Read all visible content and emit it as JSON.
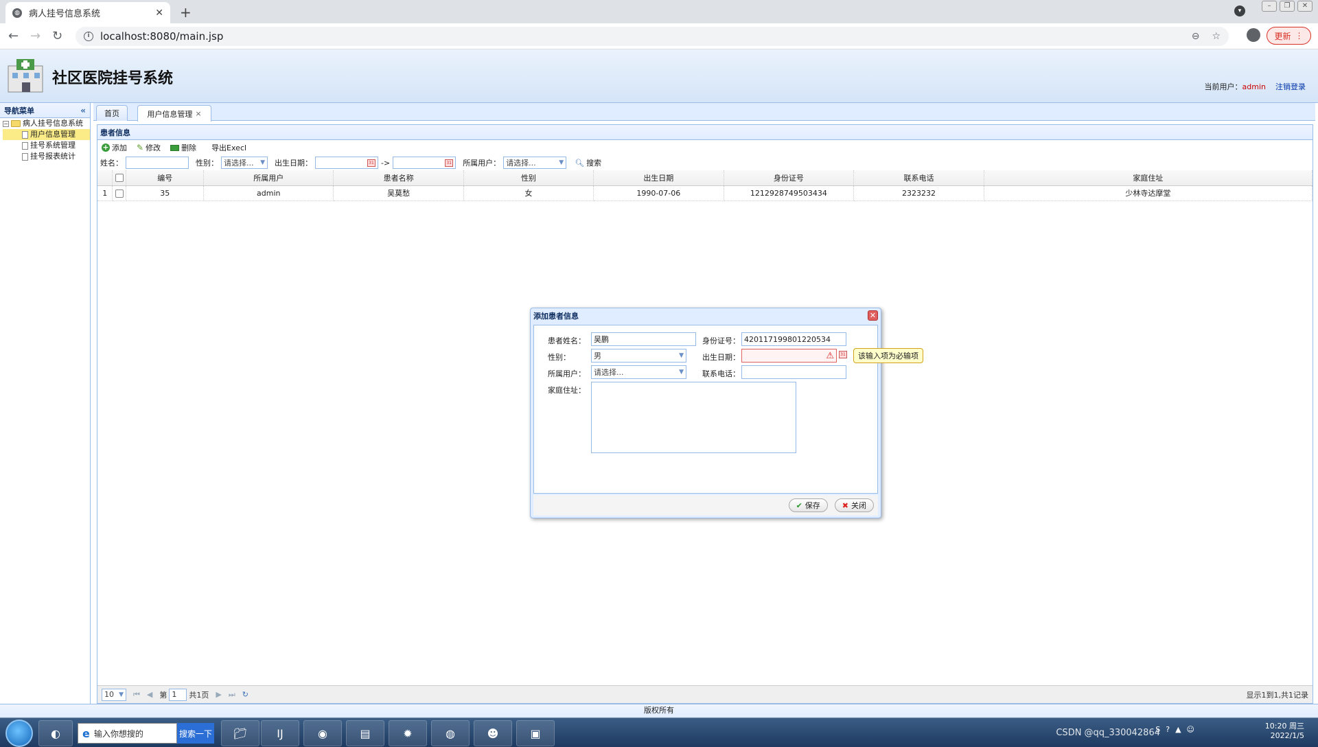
{
  "browser": {
    "tab_title": "病人挂号信息系统",
    "url": "localhost:8080/main.jsp",
    "update_label": "更新"
  },
  "header": {
    "title": "社区医院挂号系统",
    "current_user_label": "当前用户：",
    "current_user": "admin",
    "logout_label": "注销登录"
  },
  "nav": {
    "title": "导航菜单",
    "root": "病人挂号信息系统",
    "items": [
      "用户信息管理",
      "挂号系统管理",
      "挂号报表统计"
    ],
    "selected": "用户信息管理"
  },
  "tabs": [
    {
      "label": "首页"
    },
    {
      "label": "用户信息管理"
    }
  ],
  "panel": {
    "title": "患者信息",
    "actions": [
      "添加",
      "修改",
      "删除",
      "导出Execl"
    ],
    "search": {
      "name_label": "姓名：",
      "gender_label": "性别：",
      "gender_value": "请选择...",
      "birth_label": "出生日期：",
      "range_sep": "->",
      "user_label": "所属用户：",
      "user_value": "请选择...",
      "search_label": "搜索"
    },
    "columns": [
      "编号",
      "所属用户",
      "患者名称",
      "性别",
      "出生日期",
      "身份证号",
      "联系电话",
      "家庭住址"
    ],
    "rows": [
      {
        "idx": "1",
        "id": "35",
        "user": "admin",
        "name": "吴莫愁",
        "gender": "女",
        "birth": "1990-07-06",
        "idcard": "1212928749503434",
        "phone": "2323232",
        "address": "少林寺达摩堂"
      }
    ],
    "pager": {
      "page_size": "10",
      "page_label": "第",
      "page_value": "1",
      "total_pages": "共1页",
      "info": "显示1到1,共1记录"
    }
  },
  "footer": "版权所有",
  "dialog": {
    "title": "添加患者信息",
    "name_label": "患者姓名：",
    "name_value": "吴鹏",
    "idcard_label": "身份证号：",
    "idcard_value": "420117199801220534",
    "gender_label": "性别：",
    "gender_value": "男",
    "birth_label": "出生日期：",
    "birth_value": "",
    "user_label": "所属用户：",
    "user_value": "请选择...",
    "phone_label": "联系电话：",
    "phone_value": "",
    "address_label": "家庭住址：",
    "address_value": "",
    "save_label": "保存",
    "close_label": "关闭",
    "tooltip": "该输入项为必输项"
  },
  "taskbar": {
    "search_placeholder": "输入你想搜的",
    "search_button": "搜索一下",
    "clock_time": "10:20 周三",
    "clock_date": "2022/1/5",
    "watermark": "CSDN @qq_330042864"
  }
}
